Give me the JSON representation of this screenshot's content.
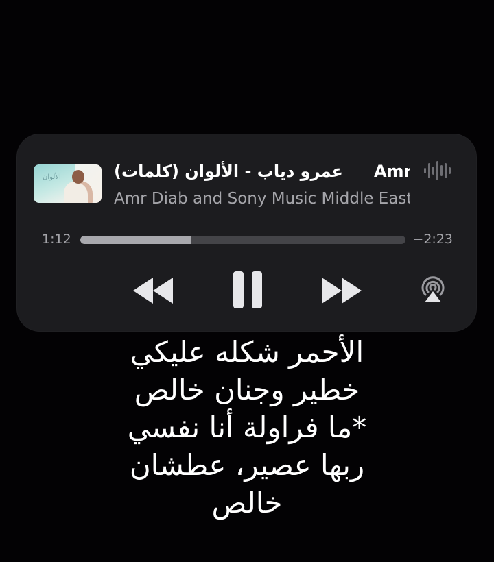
{
  "player": {
    "artwork_text": "الألوان",
    "title_lines": [
      "عمرو دياب - الألوان (كلمات)",
      "Amr Diab - Al Alwan"
    ],
    "subtitle": "Amr Diab and Sony Music Middle East",
    "time_current": "1:12",
    "time_remaining": "−2:23",
    "progress": 0.34,
    "icons": {
      "waveform": "waveform-icon",
      "rewind": "rewind-icon",
      "pause": "pause-icon",
      "forward": "fast-forward-icon",
      "airplay": "airplay-icon"
    },
    "colors": {
      "background": "#030204",
      "card": "#1c1c1f",
      "text": "#ffffff",
      "secondary_text": "#a5a5aa",
      "track": "#444448",
      "track_fill": "#a8a8ad",
      "controls": "#e7e7ea"
    }
  },
  "lyrics": {
    "lines": [
      "الأحمر شكله عليكي",
      "خطير وجنان خالص",
      "*ما فراولة أنا نفسي",
      "ربها عصير، عطشان",
      "خالص"
    ]
  }
}
